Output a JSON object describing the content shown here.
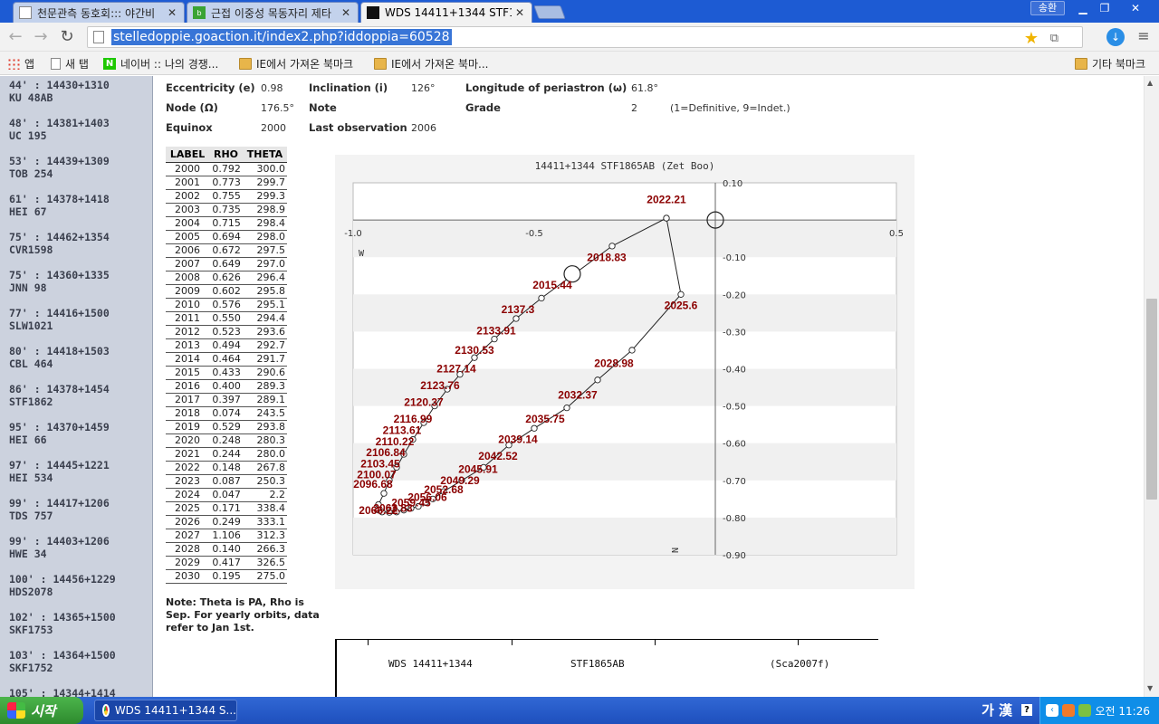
{
  "browser": {
    "tabs": [
      {
        "title": "천문관측 동호회::: 야간비",
        "icon": "bookmark-favicon"
      },
      {
        "title": "근접 이중성 목동자리 제타",
        "icon": "blog-favicon"
      },
      {
        "title": "WDS 14411+1344 STF1865",
        "icon": "site-favicon"
      }
    ],
    "user_label": "송환",
    "url": "stelledoppie.goaction.it/index2.php?iddoppia=60528",
    "bookmarks": [
      "앱",
      "새 탭",
      "네이버 :: 나의 경쟁...",
      "IE에서 가져온 북마크",
      "IE에서 가져온 북마...",
      "기타 북마크"
    ]
  },
  "sidebar": {
    "items": [
      {
        "sep": "44' : 14430+1310",
        "name": "KU 48AB"
      },
      {
        "sep": "48' : 14381+1403",
        "name": "UC 195"
      },
      {
        "sep": "53' : 14439+1309",
        "name": "TOB 254"
      },
      {
        "sep": "61' : 14378+1418",
        "name": "HEI 67"
      },
      {
        "sep": "75' : 14462+1354",
        "name": "CVR1598"
      },
      {
        "sep": "75' : 14360+1335",
        "name": "JNN 98"
      },
      {
        "sep": "77' : 14416+1500",
        "name": "SLW1021"
      },
      {
        "sep": "80' : 14418+1503",
        "name": "CBL 464"
      },
      {
        "sep": "86' : 14378+1454",
        "name": "STF1862"
      },
      {
        "sep": "95' : 14370+1459",
        "name": "HEI 66"
      },
      {
        "sep": "97' : 14445+1221",
        "name": "HEI 534"
      },
      {
        "sep": "99' : 14417+1206",
        "name": "TDS 757"
      },
      {
        "sep": "99' : 14403+1206",
        "name": "HWE 34"
      },
      {
        "sep": "100' : 14456+1229",
        "name": "HDS2078"
      },
      {
        "sep": "102' : 14365+1500",
        "name": "SKF1753"
      },
      {
        "sep": "103' : 14364+1500",
        "name": "SKF1752"
      },
      {
        "sep": "105' : 14344+1414",
        "name": ""
      }
    ]
  },
  "orbit": {
    "eccentricity_label": "Eccentricity (e)",
    "eccentricity": "0.98",
    "inclination_label": "Inclination (i)",
    "inclination": "126°",
    "periastron_label": "Longitude of periastron (ω)",
    "periastron": "61.8°",
    "node_label": "Node (Ω)",
    "node": "176.5°",
    "note_label": "Note",
    "grade_label": "Grade",
    "grade": "2",
    "grade_note": "(1=Definitive, 9=Indet.)",
    "equinox_label": "Equinox",
    "equinox": "2000",
    "lastobs_label": "Last observation",
    "lastobs": "2006"
  },
  "table": {
    "headers": [
      "LABEL",
      "RHO",
      "THETA"
    ],
    "rows": [
      [
        "2000",
        "0.792",
        "300.0"
      ],
      [
        "2001",
        "0.773",
        "299.7"
      ],
      [
        "2002",
        "0.755",
        "299.3"
      ],
      [
        "2003",
        "0.735",
        "298.9"
      ],
      [
        "2004",
        "0.715",
        "298.4"
      ],
      [
        "2005",
        "0.694",
        "298.0"
      ],
      [
        "2006",
        "0.672",
        "297.5"
      ],
      [
        "2007",
        "0.649",
        "297.0"
      ],
      [
        "2008",
        "0.626",
        "296.4"
      ],
      [
        "2009",
        "0.602",
        "295.8"
      ],
      [
        "2010",
        "0.576",
        "295.1"
      ],
      [
        "2011",
        "0.550",
        "294.4"
      ],
      [
        "2012",
        "0.523",
        "293.6"
      ],
      [
        "2013",
        "0.494",
        "292.7"
      ],
      [
        "2014",
        "0.464",
        "291.7"
      ],
      [
        "2015",
        "0.433",
        "290.6"
      ],
      [
        "2016",
        "0.400",
        "289.3"
      ],
      [
        "2017",
        "0.397",
        "289.1"
      ],
      [
        "2018",
        "0.074",
        "243.5"
      ],
      [
        "2019",
        "0.529",
        "293.8"
      ],
      [
        "2020",
        "0.248",
        "280.3"
      ],
      [
        "2021",
        "0.244",
        "280.0"
      ],
      [
        "2022",
        "0.148",
        "267.8"
      ],
      [
        "2023",
        "0.087",
        "250.3"
      ],
      [
        "2024",
        "0.047",
        "2.2"
      ],
      [
        "2025",
        "0.171",
        "338.4"
      ],
      [
        "2026",
        "0.249",
        "333.1"
      ],
      [
        "2027",
        "1.106",
        "312.3"
      ],
      [
        "2028",
        "0.140",
        "266.3"
      ],
      [
        "2029",
        "0.417",
        "326.5"
      ],
      [
        "2030",
        "0.195",
        "275.0"
      ]
    ]
  },
  "note": "Note: Theta is PA, Rho is Sep. For yearly orbits, data refer to Jan 1st.",
  "chart_data": {
    "type": "scatter",
    "title": "14411+1344 STF1865AB (Zet Boo)",
    "xlim": [
      -1.0,
      0.5
    ],
    "ylim": [
      -0.9,
      0.1
    ],
    "x_ticks": [
      -1.0,
      -0.5,
      0.5
    ],
    "x_tick_labels": [
      "-1.0",
      "-0.5",
      "0.5"
    ],
    "y_ticks": [
      0.1,
      -0.1,
      -0.2,
      -0.3,
      -0.4,
      -0.5,
      -0.6,
      -0.7,
      -0.8,
      -0.9
    ],
    "y_tick_labels": [
      "0.10",
      "-0.10",
      "-0.20",
      "-0.30",
      "-0.40",
      "-0.50",
      "-0.60",
      "-0.70",
      "-0.80",
      "-0.90"
    ],
    "x_axis_label": "W",
    "y_axis_label": "N",
    "primary": [
      0,
      0
    ],
    "companion": [
      -0.395,
      -0.145
    ],
    "orbit": [
      [
        -0.135,
        0.005
      ],
      [
        -0.285,
        -0.07
      ],
      [
        -0.48,
        -0.21
      ],
      [
        -0.55,
        -0.265
      ],
      [
        -0.61,
        -0.32
      ],
      [
        -0.665,
        -0.37
      ],
      [
        -0.705,
        -0.415
      ],
      [
        -0.74,
        -0.455
      ],
      [
        -0.775,
        -0.5
      ],
      [
        -0.805,
        -0.545
      ],
      [
        -0.835,
        -0.59
      ],
      [
        -0.86,
        -0.63
      ],
      [
        -0.88,
        -0.665
      ],
      [
        -0.9,
        -0.7
      ],
      [
        -0.915,
        -0.735
      ],
      [
        -0.93,
        -0.765
      ],
      [
        -0.93,
        -0.78
      ],
      [
        -0.92,
        -0.785
      ],
      [
        -0.9,
        -0.786
      ],
      [
        -0.88,
        -0.785
      ],
      [
        -0.86,
        -0.78
      ],
      [
        -0.84,
        -0.775
      ],
      [
        -0.82,
        -0.77
      ],
      [
        -0.8,
        -0.76
      ],
      [
        -0.78,
        -0.75
      ],
      [
        -0.75,
        -0.73
      ],
      [
        -0.7,
        -0.7
      ],
      [
        -0.64,
        -0.665
      ],
      [
        -0.57,
        -0.605
      ],
      [
        -0.5,
        -0.56
      ],
      [
        -0.41,
        -0.505
      ],
      [
        -0.325,
        -0.43
      ],
      [
        -0.23,
        -0.35
      ],
      [
        -0.095,
        -0.2
      ],
      [
        -0.135,
        0.005
      ]
    ],
    "labels": [
      {
        "text": "2022.21",
        "x": -0.135,
        "y": 0.045
      },
      {
        "text": "2018.83",
        "x": -0.3,
        "y": -0.11
      },
      {
        "text": "2015.44",
        "x": -0.45,
        "y": -0.185
      },
      {
        "text": "2025.6",
        "x": -0.095,
        "y": -0.24
      },
      {
        "text": "2137.3",
        "x": -0.545,
        "y": -0.25
      },
      {
        "text": "2133.91",
        "x": -0.605,
        "y": -0.308
      },
      {
        "text": "2130.53",
        "x": -0.665,
        "y": -0.36
      },
      {
        "text": "2127.14",
        "x": -0.715,
        "y": -0.41
      },
      {
        "text": "2123.76",
        "x": -0.76,
        "y": -0.455
      },
      {
        "text": "2120.37",
        "x": -0.805,
        "y": -0.5
      },
      {
        "text": "2116.99",
        "x": -0.835,
        "y": -0.545
      },
      {
        "text": "2113.61",
        "x": -0.865,
        "y": -0.575
      },
      {
        "text": "2110.22",
        "x": -0.885,
        "y": -0.605
      },
      {
        "text": "2106.84",
        "x": -0.91,
        "y": -0.635
      },
      {
        "text": "2103.45",
        "x": -0.925,
        "y": -0.665
      },
      {
        "text": "2100.07",
        "x": -0.935,
        "y": -0.695
      },
      {
        "text": "2096.68",
        "x": -0.945,
        "y": -0.72
      },
      {
        "text": "2028.98",
        "x": -0.28,
        "y": -0.395
      },
      {
        "text": "2032.37",
        "x": -0.38,
        "y": -0.48
      },
      {
        "text": "2035.75",
        "x": -0.47,
        "y": -0.545
      },
      {
        "text": "2039.14",
        "x": -0.545,
        "y": -0.6
      },
      {
        "text": "2042.52",
        "x": -0.6,
        "y": -0.645
      },
      {
        "text": "2045.91",
        "x": -0.655,
        "y": -0.68
      },
      {
        "text": "2049.29",
        "x": -0.705,
        "y": -0.71
      },
      {
        "text": "2052.68",
        "x": -0.75,
        "y": -0.735
      },
      {
        "text": "2056.06",
        "x": -0.795,
        "y": -0.755
      },
      {
        "text": "2059.45",
        "x": -0.84,
        "y": -0.77
      },
      {
        "text": "2062.83",
        "x": -0.89,
        "y": -0.785
      },
      {
        "text": "2066.22",
        "x": -0.93,
        "y": -0.79
      }
    ]
  },
  "bottom_box": {
    "wds": "WDS 14411+1344",
    "disc": "STF1865AB",
    "ref": "(Sca2007f)"
  },
  "taskbar": {
    "start_label": "시작",
    "task_title": "WDS 14411+1344 S...",
    "ime": "가 漢",
    "clock": "오전 11:26"
  },
  "colors": {
    "titlebar": "#1d5bd3",
    "sidebar": "#ccd2de",
    "chart_label": "#8b0000",
    "taskbar": "#245edb"
  }
}
